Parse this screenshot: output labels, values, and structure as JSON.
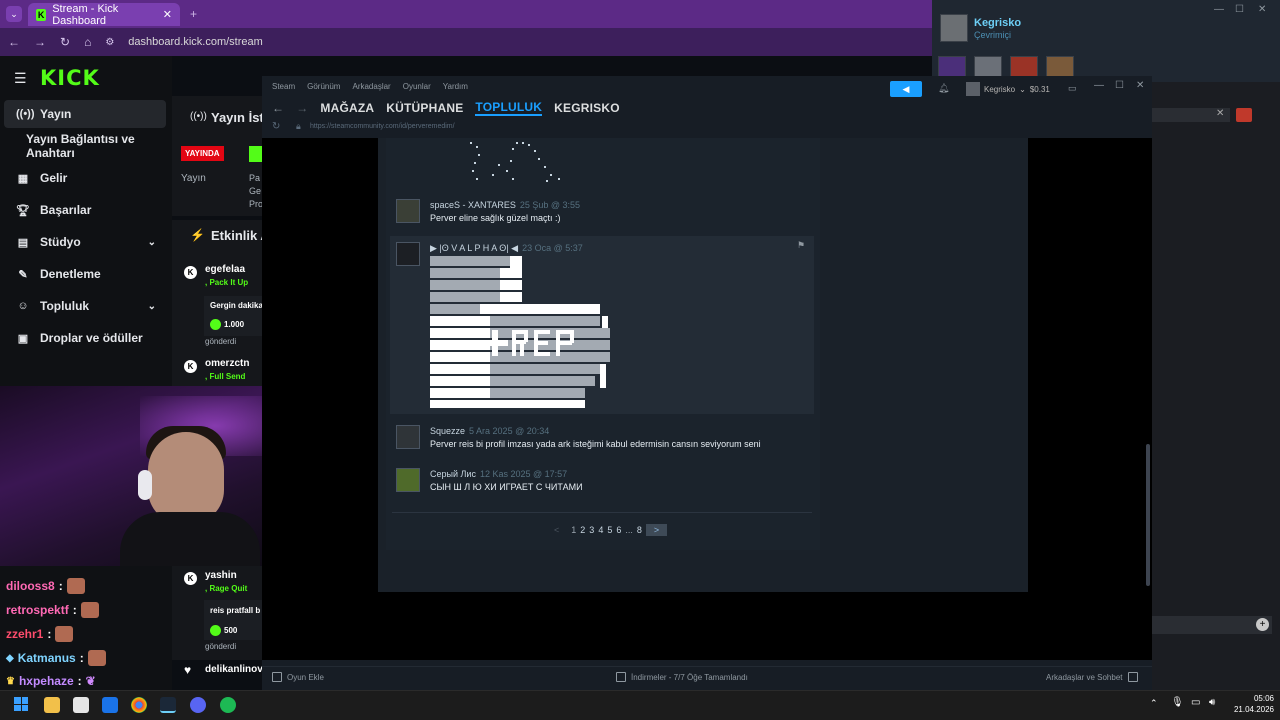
{
  "browser": {
    "tab_title": "Stream - Kick Dashboard",
    "url": "dashboard.kick.com/stream"
  },
  "kick": {
    "logo": "KICK",
    "nav": [
      {
        "label": "Yayın",
        "icon": "broadcast-icon"
      },
      {
        "label": "Yayın Bağlantısı ve Anahtarı",
        "icon": ""
      },
      {
        "label": "Gelir",
        "icon": "revenue-icon"
      },
      {
        "label": "Başarılar",
        "icon": "trophy-icon"
      },
      {
        "label": "Stüdyo",
        "icon": "studio-icon"
      },
      {
        "label": "Denetleme",
        "icon": "wrench-icon"
      },
      {
        "label": "Topluluk",
        "icon": "community-icon"
      },
      {
        "label": "Droplar ve ödüller",
        "icon": "gift-icon"
      }
    ],
    "stream_header": "Yayın İsta",
    "live_badge": "YAYINDA",
    "yayin_label": "Yayın",
    "stats_labels": [
      "Pa",
      "Ge",
      "Pro"
    ],
    "activity_header": "Etkinlik A",
    "events": [
      {
        "user": "egefelaa",
        "action": ", Pack It Up",
        "message": "Gergin dakika",
        "amount": "1.000",
        "sent": "gönderdi"
      },
      {
        "user": "omerzctn",
        "action": ", Full Send"
      },
      {
        "user": "yashin",
        "action": ", Rage Quit",
        "message": "reis pratfall b",
        "amount": "500",
        "sent": "gönderdi"
      },
      {
        "user": "delikanlinova",
        "action": ""
      }
    ],
    "chat": [
      {
        "user": "dilooss8",
        "color": "#ff69b4"
      },
      {
        "user": "retrospektf",
        "color": "#ff69b4"
      },
      {
        "user": "zzehr1",
        "color": "#ff4d6d"
      },
      {
        "user": "Katmanus",
        "color": "#7fd4ff"
      },
      {
        "user": "hxpehaze",
        "color": "#c38bff"
      }
    ]
  },
  "friends": {
    "name": "Kegrisko",
    "status": "Çevrimiçi"
  },
  "steam": {
    "menu": [
      "Steam",
      "Görünüm",
      "Arkadaşlar",
      "Oyunlar",
      "Yardım"
    ],
    "nav": [
      "MAĞAZA",
      "KÜTÜPHANE",
      "TOPLULUK",
      "KEGRISKO"
    ],
    "active_nav": "TOPLULUK",
    "url": "https://steamcommunity.com/id/perveremedim/",
    "account": "Kegrisko",
    "balance": "$0.31",
    "comments": [
      {
        "author": "spaceS - XANTARES",
        "date": "25 Şub @ 3:55",
        "text": "Perver eline sağlık güzel maçtı :)"
      },
      {
        "author": "▶ |ʘ V A L P H A ʘ| ◀",
        "date": "23 Oca @ 5:37",
        "text": "+REP"
      },
      {
        "author": "Squezze",
        "date": "5 Ara 2025 @ 20:34",
        "text": "Perver reis bi profil imzası yada ark isteğimi kabul edermisin cansın seviyorum seni"
      },
      {
        "author": "Серый Лис",
        "date": "12 Kas 2025 @ 17:57",
        "text": "СЫН Ш Л Ю ХИ ИГРАЕТ С ЧИТАМИ"
      }
    ],
    "pager": {
      "prev": "<",
      "pages": [
        "1",
        "2",
        "3",
        "4",
        "5",
        "6",
        "...",
        "8"
      ],
      "next": ">"
    },
    "footer": {
      "add_game": "Oyun Ekle",
      "downloads": "İndirmeler - 7/7 Öğe Tamamlandı",
      "friends_chat": "Arkadaşlar ve Sohbet"
    }
  },
  "taskbar": {
    "time": "05:06",
    "date": "21.04.2026"
  },
  "colors": {
    "kick_green": "#53fc18",
    "steam_blue": "#1a9fff",
    "browser_purple": "#5c2a86"
  }
}
